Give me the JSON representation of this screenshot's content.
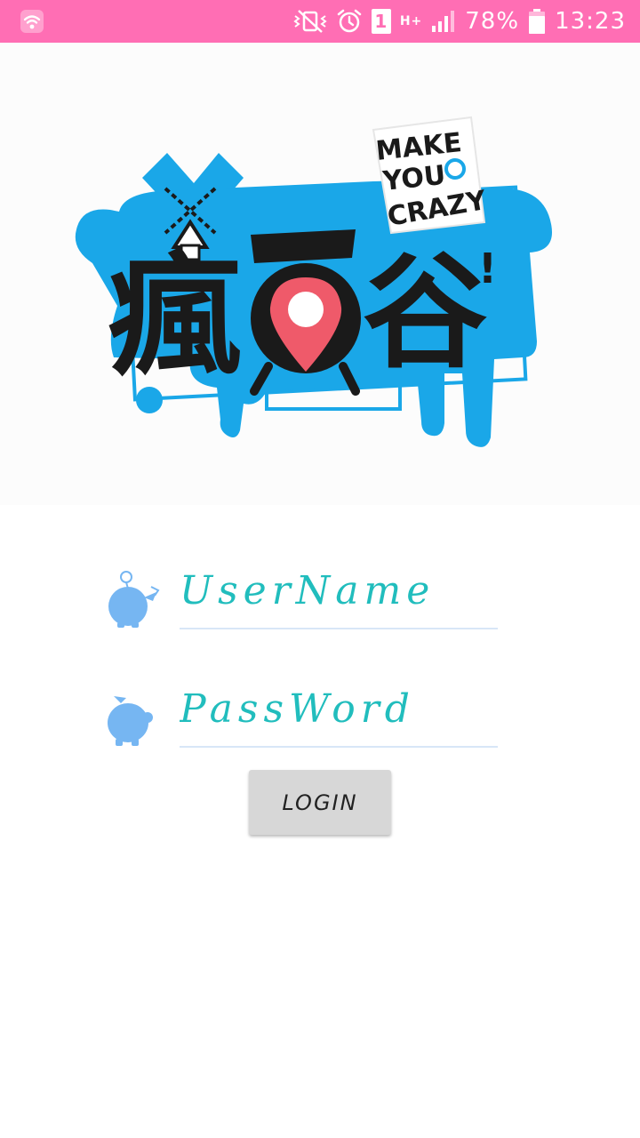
{
  "status_bar": {
    "sim_slot": "1",
    "network_type": "H+",
    "battery": "78%",
    "time": "13:23",
    "icons": [
      "wifi-icon",
      "mute-vibrate-icon",
      "alarm-icon",
      "sim-icon",
      "signal-icon",
      "battery-icon"
    ]
  },
  "logo": {
    "tagline": [
      "MAKE",
      "YOU",
      "CRAZY"
    ],
    "title_chars": [
      "瘋",
      "谷"
    ],
    "exclamation": "!"
  },
  "form": {
    "username_placeholder": "UserName",
    "password_placeholder": "PassWord",
    "login_label": "LOGIN"
  },
  "colors": {
    "status_bar": "#ff6eb4",
    "accent_text": "#21bdbd",
    "logo_blue": "#1aa7e8",
    "pin_red": "#ef5a6a",
    "avatar_blue": "#76b6f2",
    "button_bg": "#d7d7d7"
  }
}
